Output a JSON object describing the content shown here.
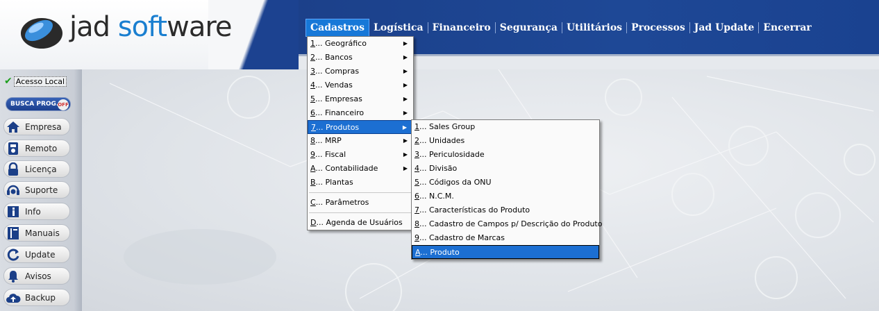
{
  "logo": {
    "part1": "jad ",
    "part2": "soft",
    "part3": "ware"
  },
  "menubar": [
    {
      "label": "Cadastros",
      "active": true
    },
    {
      "label": "Logística",
      "active": false
    },
    {
      "label": "Financeiro",
      "active": false
    },
    {
      "label": "Segurança",
      "active": false
    },
    {
      "label": "Utilitários",
      "active": false
    },
    {
      "label": "Processos",
      "active": false
    },
    {
      "label": "Jad Update",
      "active": false
    },
    {
      "label": "Encerrar",
      "active": false
    }
  ],
  "sidebar": {
    "acesso": "Acesso Local",
    "busca": {
      "label": "BUSCA PROG.",
      "toggle": "OFF"
    },
    "buttons": [
      {
        "label": "Empresa",
        "icon": "home-icon"
      },
      {
        "label": "Remoto",
        "icon": "remote-icon"
      },
      {
        "label": "Licença",
        "icon": "lock-icon"
      },
      {
        "label": "Suporte",
        "icon": "headset-icon"
      },
      {
        "label": "Info",
        "icon": "info-icon"
      },
      {
        "label": "Manuais",
        "icon": "book-icon"
      },
      {
        "label": "Update",
        "icon": "refresh-icon"
      },
      {
        "label": "Avisos",
        "icon": "bell-icon"
      },
      {
        "label": "Backup",
        "icon": "cloud-upload-icon"
      }
    ]
  },
  "cadastros_menu": [
    {
      "key": "1",
      "label": "... Geográfico",
      "submenu": true
    },
    {
      "key": "2",
      "label": "... Bancos",
      "submenu": true
    },
    {
      "key": "3",
      "label": "... Compras",
      "submenu": true
    },
    {
      "key": "4",
      "label": "... Vendas",
      "submenu": true
    },
    {
      "key": "5",
      "label": "... Empresas",
      "submenu": true
    },
    {
      "key": "6",
      "label": "... Financeiro",
      "submenu": true
    },
    {
      "key": "7",
      "label": "... Produtos",
      "submenu": true,
      "highlighted": true
    },
    {
      "key": "8",
      "label": "... MRP",
      "submenu": true
    },
    {
      "key": "9",
      "label": "... Fiscal",
      "submenu": true
    },
    {
      "key": "A",
      "label": "... Contabilidade",
      "submenu": true
    },
    {
      "key": "B",
      "label": "... Plantas",
      "submenu": false
    },
    {
      "key": "C",
      "label": "... Parâmetros",
      "submenu": false,
      "divider_before": true
    },
    {
      "key": "D",
      "label": "... Agenda de Usuários",
      "submenu": false,
      "divider_before": true
    }
  ],
  "produtos_menu": [
    {
      "key": "1",
      "label": "... Sales Group"
    },
    {
      "key": "2",
      "label": "... Unidades"
    },
    {
      "key": "3",
      "label": "... Periculosidade"
    },
    {
      "key": "4",
      "label": "... Divisão"
    },
    {
      "key": "5",
      "label": "... Códigos da ONU"
    },
    {
      "key": "6",
      "label": "... N.C.M."
    },
    {
      "key": "7",
      "label": "... Características do Produto"
    },
    {
      "key": "8",
      "label": "... Cadastro de Campos p/ Descrição do Produto"
    },
    {
      "key": "9",
      "label": "... Cadastro de Marcas"
    },
    {
      "key": "A",
      "label": "... Produto",
      "highlighted": true
    }
  ],
  "colors": {
    "brand_blue": "#1b3f88",
    "highlight": "#1c6fd2",
    "logo_blue": "#1a7fd0"
  }
}
